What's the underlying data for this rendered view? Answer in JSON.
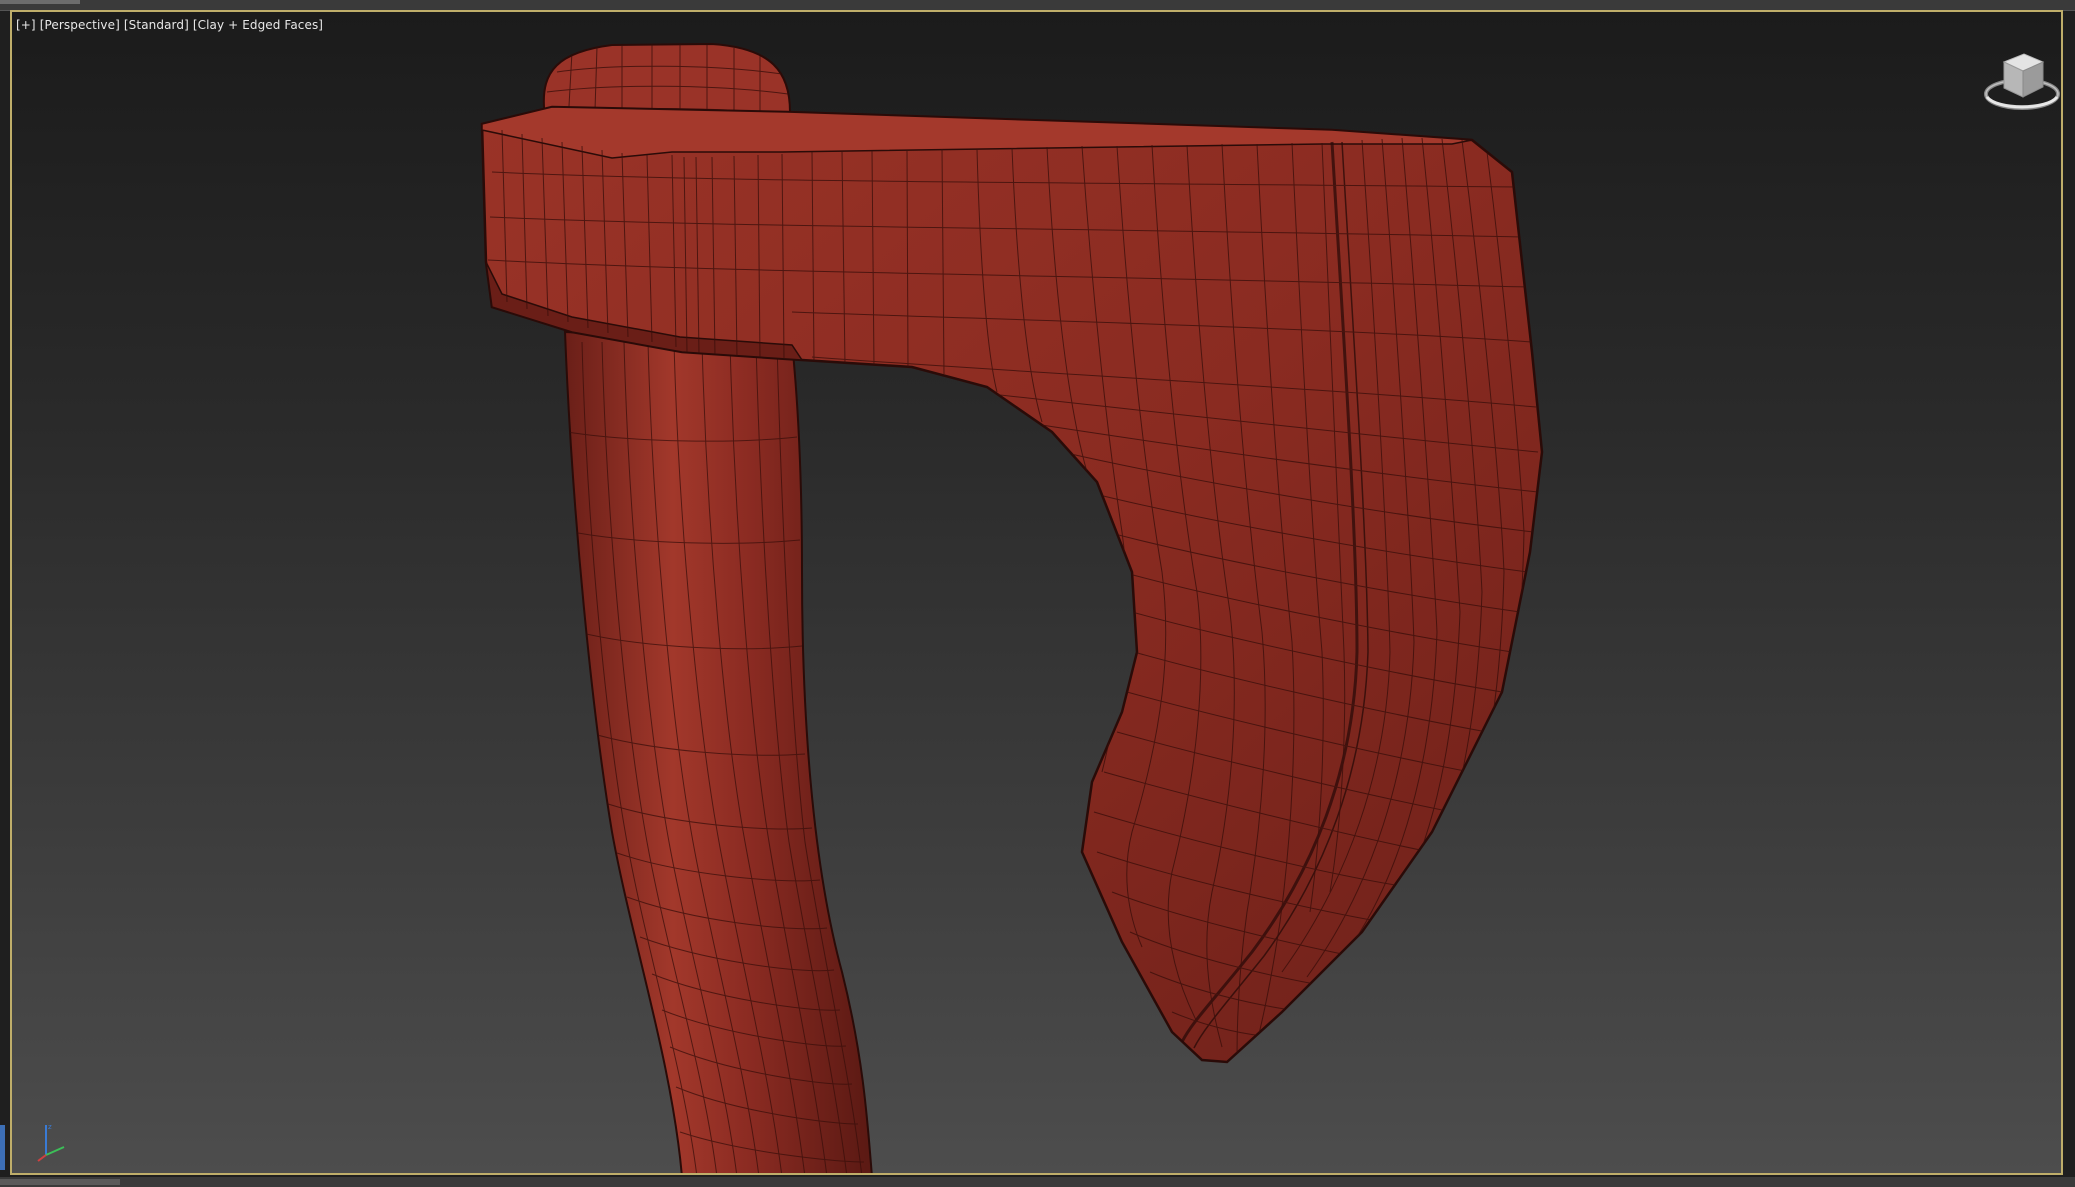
{
  "viewport": {
    "label_parts": [
      "[+]",
      "[Perspective]",
      "[Standard]",
      "[Clay + Edged Faces]"
    ],
    "active_border_color": "#bfae6a",
    "background_top": "#1b1b1b",
    "background_bottom": "#4d4d4d"
  },
  "model": {
    "material_color": "#8b2b22",
    "highlight_color": "#a8392c",
    "shadow_color": "#5e1a15",
    "wire_color": "#2a0b08"
  },
  "icons": {
    "viewcube": "viewcube-icon",
    "axis": "axis-tripod-icon"
  }
}
